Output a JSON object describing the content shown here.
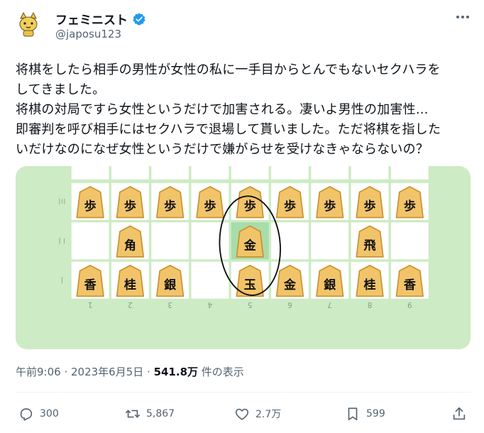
{
  "user": {
    "display_name": "フェミニスト",
    "handle": "@japosu123"
  },
  "tweet": {
    "text": "将棋をしたら相手の男性が女性の私に一手目からとんでもないセクハラを\nしてきました。\n将棋の対局ですら女性というだけで加害される。凄いよ男性の加害性...\n即審判を呼び相手にはセクハラで退場して貰いました。ただ将棋を指した\nいだけなのになぜ女性というだけで嫌がらせを受けなきゃならないの？"
  },
  "meta": {
    "time_date": "午前9:06 · 2023年6月5日 · ",
    "views_count": "541.8万",
    "views_suffix": " 件の表示"
  },
  "actions": {
    "replies": "300",
    "retweets": "5,867",
    "likes": "2.7万",
    "bookmarks": "599"
  },
  "board": {
    "rows": [
      [
        "歩",
        "歩",
        "歩",
        "歩",
        "歩",
        "歩",
        "歩",
        "歩",
        "歩"
      ],
      [
        "",
        "角",
        "",
        "",
        "金",
        "",
        "",
        "飛",
        ""
      ],
      [
        "香",
        "桂",
        "銀",
        "",
        "玉",
        "金",
        "銀",
        "桂",
        "香"
      ]
    ],
    "file_labels": [
      "1",
      "2",
      "3",
      "4",
      "5",
      "6",
      "7",
      "8",
      "9"
    ],
    "rank_labels": [
      "三",
      "二",
      "一"
    ],
    "highlight_cell": [
      1,
      4
    ]
  },
  "colors": {
    "board_bg": "#cdebc4",
    "cell": "#ffffff",
    "highlight": "#a8dcaa",
    "piece_face": "#f2c46a",
    "piece_edge": "#c9922e",
    "verified": "#1d9bf0"
  }
}
